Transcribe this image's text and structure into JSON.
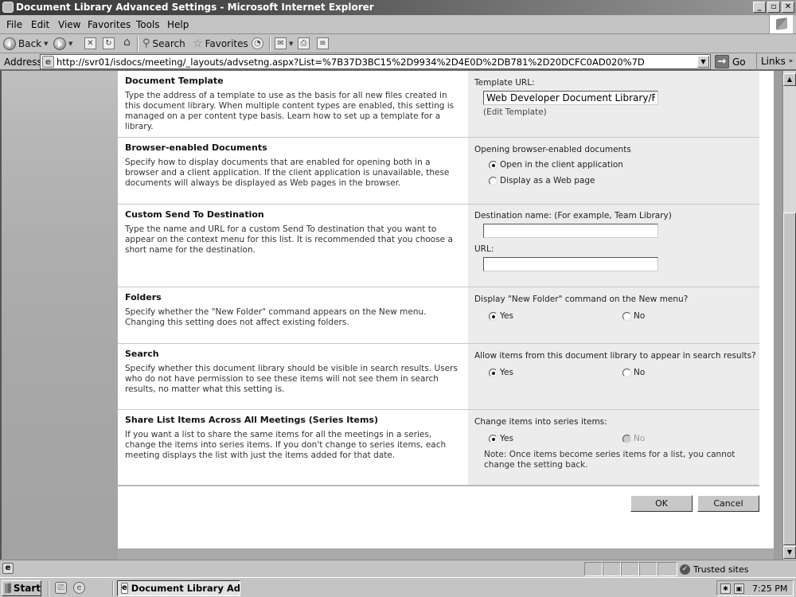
{
  "window": {
    "title": "Document Library Advanced Settings - Microsoft Internet Explorer",
    "controls": {
      "minimize": "_",
      "restore": "▫",
      "close": "✕"
    }
  },
  "menu": [
    "File",
    "Edit",
    "View",
    "Favorites",
    "Tools",
    "Help"
  ],
  "toolbar": {
    "back_label": "Back",
    "search_label": "Search",
    "favorites_label": "Favorites",
    "icons": [
      "back-icon",
      "forward-icon",
      "stop-icon",
      "refresh-icon",
      "home-icon",
      "search-icon",
      "favorites-icon",
      "history-icon",
      "mail-icon",
      "print-icon",
      "edit-icon"
    ]
  },
  "address": {
    "label": "Address",
    "url": "http://svr01/isdocs/meeting/_layouts/advsetng.aspx?List=%7B37D3BC15%2D9934%2D4E0D%2DB781%2D20DCFC0AD020%7D",
    "go_label": "Go",
    "links_label": "Links"
  },
  "sections": [
    {
      "title": "Document Template",
      "description": "Type the address of a template to use as the basis for all new files created in this document library. When multiple content types are enabled, this setting is managed on a per content type basis. Learn how to set up a template for a library.",
      "field_label": "Template URL:",
      "field_value": "Web Developer Document Library/Forms/template.doc",
      "link": "(Edit Template)"
    },
    {
      "title": "Browser-enabled Documents",
      "description": "Specify how to display documents that are enabled for opening both in a browser and a client application. If the client application is unavailable, these documents will always be displayed as Web pages in the browser.",
      "question": "Opening browser-enabled documents",
      "options": [
        {
          "label": "Open in the client application",
          "selected": true
        },
        {
          "label": "Display as a Web page",
          "selected": false
        }
      ]
    },
    {
      "title": "Custom Send To Destination",
      "description": "Type the name and URL for a custom Send To destination that you want to appear on the context menu for this list. It is recommended that you choose a short name for the destination.",
      "name_label": "Destination name: (For example, Team Library)",
      "name_value": "",
      "url_label": "URL:",
      "url_value": ""
    },
    {
      "title": "Folders",
      "description": "Specify whether the \"New Folder\" command appears on the New menu. Changing this setting does not affect existing folders.",
      "question": "Display \"New Folder\" command on the New menu?",
      "options": [
        {
          "label": "Yes",
          "selected": true
        },
        {
          "label": "No",
          "selected": false
        }
      ]
    },
    {
      "title": "Search",
      "description": "Specify whether this document library should be visible in search results. Users who do not have permission to see these items will not see them in search results, no matter what this setting is.",
      "question": "Allow items from this document library to appear in search results?",
      "options": [
        {
          "label": "Yes",
          "selected": true
        },
        {
          "label": "No",
          "selected": false
        }
      ]
    },
    {
      "title": "Share List Items Across All Meetings (Series Items)",
      "description": "If you want a list to share the same items for all the meetings in a series, change the items into series items.  If you don't change to series items, each meeting displays the list with just the items added for that date.",
      "question": "Change items into series items:",
      "options": [
        {
          "label": "Yes",
          "selected": true
        },
        {
          "label": "No",
          "selected": false,
          "disabled": true
        }
      ],
      "note": "Note: Once items become series items for a list, you cannot change the setting back."
    }
  ],
  "buttons": {
    "ok": "OK",
    "cancel": "Cancel"
  },
  "status": {
    "zone": "Trusted sites"
  },
  "taskbar": {
    "start": "Start",
    "task": "Document Library Ad...",
    "clock": "7:25 PM"
  }
}
